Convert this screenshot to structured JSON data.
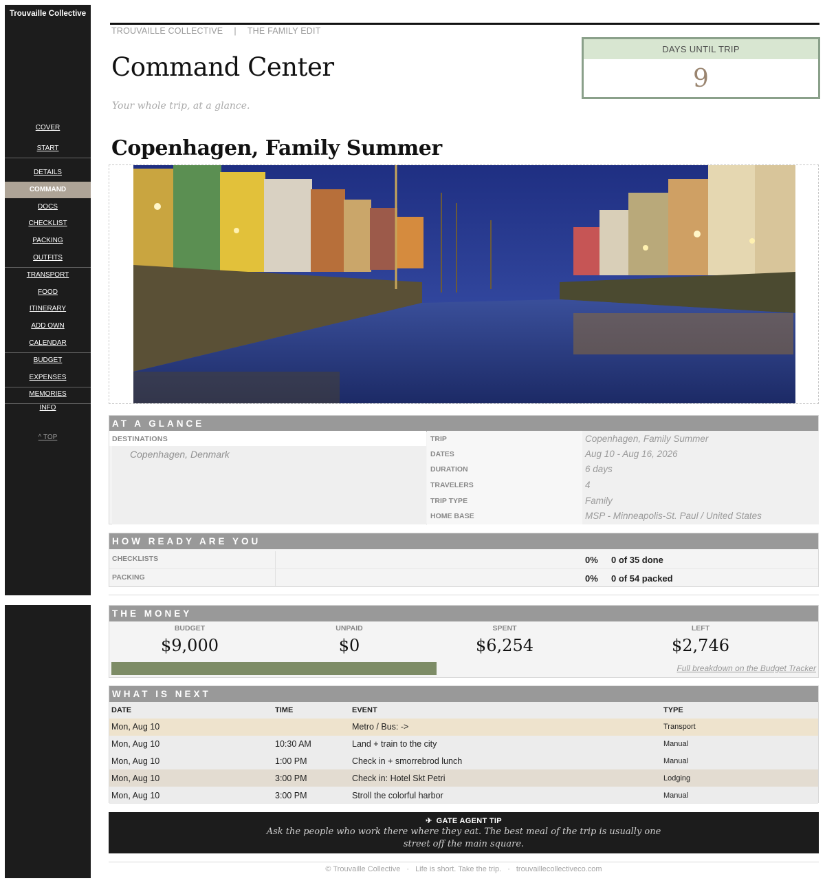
{
  "brand": "Trouvaille Collective",
  "nav": {
    "items": [
      {
        "label": "COVER"
      },
      {
        "label": "START"
      },
      {
        "label": "DETAILS"
      },
      {
        "label": "COMMAND"
      },
      {
        "label": "DOCS"
      },
      {
        "label": "CHECKLIST"
      },
      {
        "label": "PACKING"
      },
      {
        "label": "OUTFITS"
      },
      {
        "label": "TRANSPORT"
      },
      {
        "label": "FOOD"
      },
      {
        "label": "ITINERARY"
      },
      {
        "label": "ADD OWN"
      },
      {
        "label": "CALENDAR"
      },
      {
        "label": "BUDGET"
      },
      {
        "label": "EXPENSES"
      },
      {
        "label": "MEMORIES"
      },
      {
        "label": "INFO"
      }
    ],
    "active": "COMMAND",
    "top_link": "^ TOP"
  },
  "breadcrumb": {
    "brand": "TROUVAILLE COLLECTIVE",
    "separator": "|",
    "section": "THE FAMILY EDIT"
  },
  "page": {
    "title": "Command Center",
    "subtitle": "Your whole trip, at a glance."
  },
  "countdown": {
    "label": "DAYS UNTIL TRIP",
    "value": "9"
  },
  "trip_title": "Copenhagen, Family Summer",
  "glance": {
    "heading": "AT A GLANCE",
    "destinations_label": "DESTINATIONS",
    "destination": "Copenhagen, Denmark",
    "fields": [
      {
        "key": "TRIP",
        "value": "Copenhagen, Family Summer"
      },
      {
        "key": "DATES",
        "value": "Aug 10 - Aug 16, 2026"
      },
      {
        "key": "DURATION",
        "value": "6 days"
      },
      {
        "key": "TRAVELERS",
        "value": "4"
      },
      {
        "key": "TRIP TYPE",
        "value": "Family"
      },
      {
        "key": "HOME BASE",
        "value": "MSP - Minneapolis-St. Paul / United States"
      }
    ]
  },
  "ready": {
    "heading": "HOW READY ARE YOU",
    "rows": [
      {
        "label": "CHECKLISTS",
        "pct": "0%",
        "count": "0 of 35 done"
      },
      {
        "label": "PACKING",
        "pct": "0%",
        "count": "0 of 54 packed"
      }
    ]
  },
  "money": {
    "heading": "THE MONEY",
    "budget_label": "BUDGET",
    "budget": "$9,000",
    "unpaid_label": "UNPAID",
    "unpaid": "$0",
    "spent_label": "SPENT",
    "spent": "$6,254",
    "left_label": "LEFT",
    "left": "$2,746",
    "spent_fraction": 0.695,
    "link": "Full breakdown on the Budget Tracker",
    "bar_color": "#7d8c66"
  },
  "next": {
    "heading": "WHAT IS NEXT",
    "columns": {
      "date": "DATE",
      "time": "TIME",
      "event": "EVENT",
      "type": "TYPE"
    },
    "rows": [
      {
        "date": "Mon, Aug 10",
        "time": "",
        "event": "Metro / Bus:  ->",
        "type": "Transport"
      },
      {
        "date": "Mon, Aug 10",
        "time": "10:30 AM",
        "event": "Land + train to the city",
        "type": "Manual"
      },
      {
        "date": "Mon, Aug 10",
        "time": "1:00 PM",
        "event": "Check in + smorrebrod lunch",
        "type": "Manual"
      },
      {
        "date": "Mon, Aug 10",
        "time": "3:00 PM",
        "event": "Check in: Hotel Skt Petri",
        "type": "Lodging"
      },
      {
        "date": "Mon, Aug 10",
        "time": "3:00 PM",
        "event": "Stroll the colorful harbor",
        "type": "Manual"
      }
    ]
  },
  "tip": {
    "icon": "airplane-icon",
    "title": "GATE AGENT TIP",
    "text": "Ask the people who work there where they eat. The best meal of the trip is usually one street off the main square."
  },
  "footer": {
    "copyright": "© Trouvaille Collective",
    "tagline": "Life is short. Take the trip.",
    "site": "trouvaillecollectiveco.com"
  }
}
